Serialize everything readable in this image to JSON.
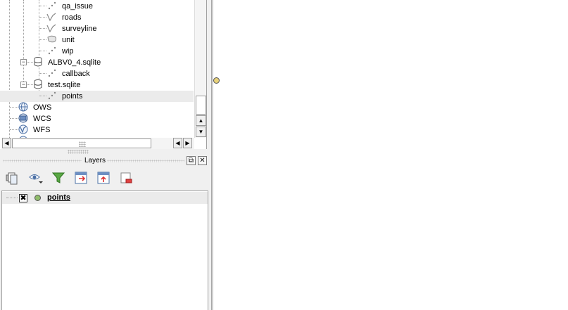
{
  "browser": {
    "items": [
      {
        "label": "qa_issue",
        "icon": "point-layer-icon"
      },
      {
        "label": "roads",
        "icon": "line-layer-icon"
      },
      {
        "label": "surveyline",
        "icon": "line-layer-icon"
      },
      {
        "label": "unit",
        "icon": "polygon-layer-icon"
      },
      {
        "label": "wip",
        "icon": "point-layer-icon"
      },
      {
        "label": "ALBV0_4.sqlite",
        "icon": "database-icon"
      },
      {
        "label": "callback",
        "icon": "point-layer-icon"
      },
      {
        "label": "test.sqlite",
        "icon": "database-icon"
      },
      {
        "label": "points",
        "icon": "point-layer-icon"
      },
      {
        "label": "OWS",
        "icon": "globe-icon"
      },
      {
        "label": "WCS",
        "icon": "wcs-icon"
      },
      {
        "label": "WFS",
        "icon": "wfs-icon"
      }
    ]
  },
  "layers_panel": {
    "title": "Layers",
    "toolbar": [
      "open-layer-styling-icon",
      "manage-visibility-icon",
      "filter-legend-icon",
      "expand-all-icon",
      "collapse-all-icon",
      "remove-layer-icon"
    ],
    "layers": [
      {
        "name": "points",
        "visible": true,
        "symbol_color": "#8fbc6a"
      }
    ]
  },
  "map": {
    "point_color": "#e8d27a"
  }
}
